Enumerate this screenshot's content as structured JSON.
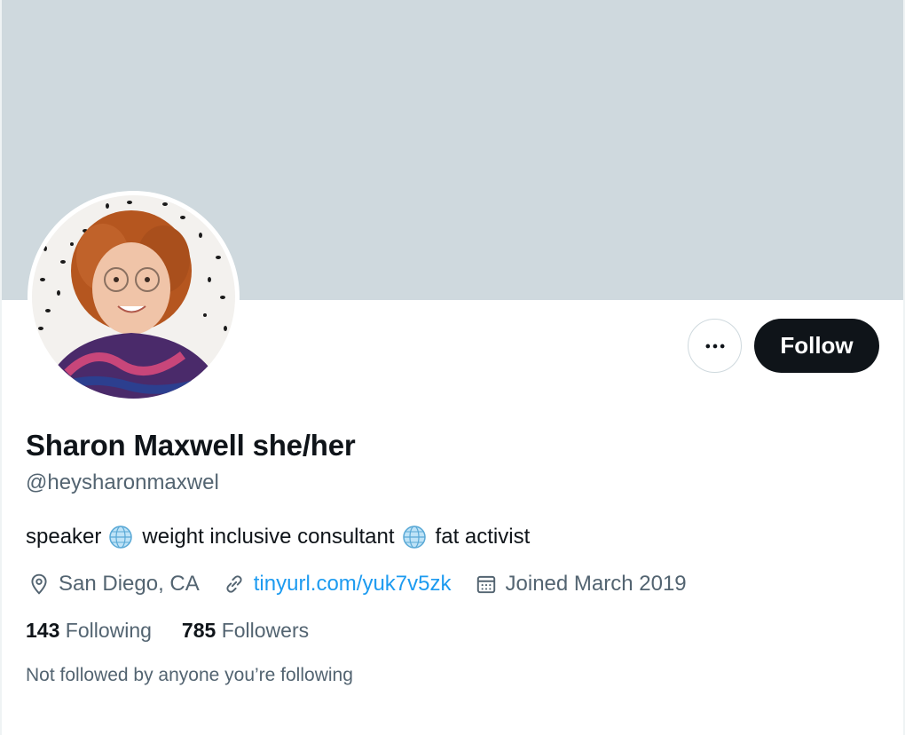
{
  "profile": {
    "name": "Sharon Maxwell she/her",
    "handle": "@heysharonmaxwel",
    "bio": {
      "part1": "speaker",
      "part2": "weight inclusive consultant",
      "part3": "fat activist",
      "emoji": "globe-icon"
    },
    "location": "San Diego, CA",
    "website": "tinyurl.com/yuk7v5zk",
    "joined": "Joined March 2019"
  },
  "actions": {
    "follow_label": "Follow",
    "more_icon": "more-icon"
  },
  "stats": {
    "following_count": "143",
    "following_label": "Following",
    "followers_count": "785",
    "followers_label": "Followers"
  },
  "social_context": "Not followed by anyone you’re following",
  "colors": {
    "banner": "#cfd9de",
    "link": "#1d9bf0",
    "button": "#0f1419",
    "secondary_text": "#536471"
  }
}
